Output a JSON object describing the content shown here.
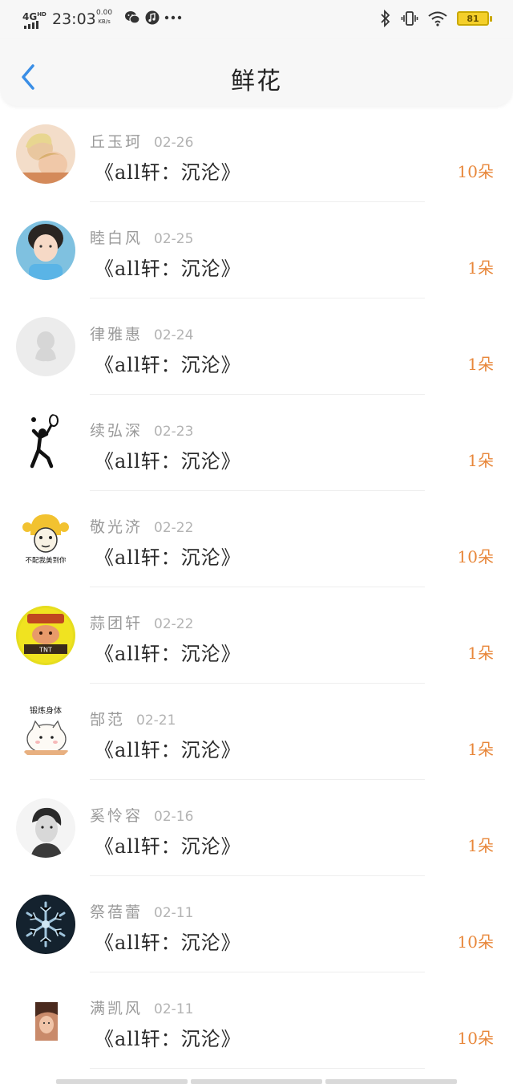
{
  "status_bar": {
    "network": "4G",
    "network_sup": "HD",
    "time": "23:03",
    "speed_value": "0.00",
    "speed_unit": "KB/s",
    "battery": "81",
    "icons_left": [
      "wechat-icon",
      "music-icon",
      "more-dots-icon"
    ],
    "icons_right": [
      "bluetooth-icon",
      "vibrate-icon",
      "wifi-icon",
      "battery-icon"
    ]
  },
  "header": {
    "title": "鲜花",
    "back_icon": "chevron-left-icon",
    "accent_color": "#3a8ee6"
  },
  "list": [
    {
      "name": "丘玉珂",
      "date": "02-26",
      "book": "《all轩：沉沦》",
      "count": "10朵",
      "avatar": "photo-couple"
    },
    {
      "name": "睦白风",
      "date": "02-25",
      "book": "《all轩：沉沦》",
      "count": "1朵",
      "avatar": "photo-child"
    },
    {
      "name": "律雅惠",
      "date": "02-24",
      "book": "《all轩：沉沦》",
      "count": "1朵",
      "avatar": "default-penguin"
    },
    {
      "name": "续弘深",
      "date": "02-23",
      "book": "《all轩：沉沦》",
      "count": "1朵",
      "avatar": "stick-figure"
    },
    {
      "name": "敬光济",
      "date": "02-22",
      "book": "《all轩：沉沦》",
      "count": "10朵",
      "avatar": "meme-girl",
      "avatar_caption": "不配我美到你"
    },
    {
      "name": "蒜团轩",
      "date": "02-22",
      "book": "《all轩：沉沦》",
      "count": "1朵",
      "avatar": "tnt-badge",
      "avatar_caption": "TNT"
    },
    {
      "name": "郜范",
      "date": "02-21",
      "book": "《all轩：沉沦》",
      "count": "1朵",
      "avatar": "cartoon-cat",
      "avatar_caption": "锻炼身体"
    },
    {
      "name": "奚怜容",
      "date": "02-16",
      "book": "《all轩：沉沦》",
      "count": "1朵",
      "avatar": "photo-bw"
    },
    {
      "name": "祭蓓蕾",
      "date": "02-11",
      "book": "《all轩：沉沦》",
      "count": "10朵",
      "avatar": "snowflake"
    },
    {
      "name": "满凯风",
      "date": "02-11",
      "book": "《all轩：沉沦》",
      "count": "10朵",
      "avatar": "photo-small"
    }
  ],
  "colors": {
    "count": "#e8873a",
    "name": "#9a9a9a",
    "date": "#b3b3b3",
    "header_bg": "#f7f7f7"
  }
}
